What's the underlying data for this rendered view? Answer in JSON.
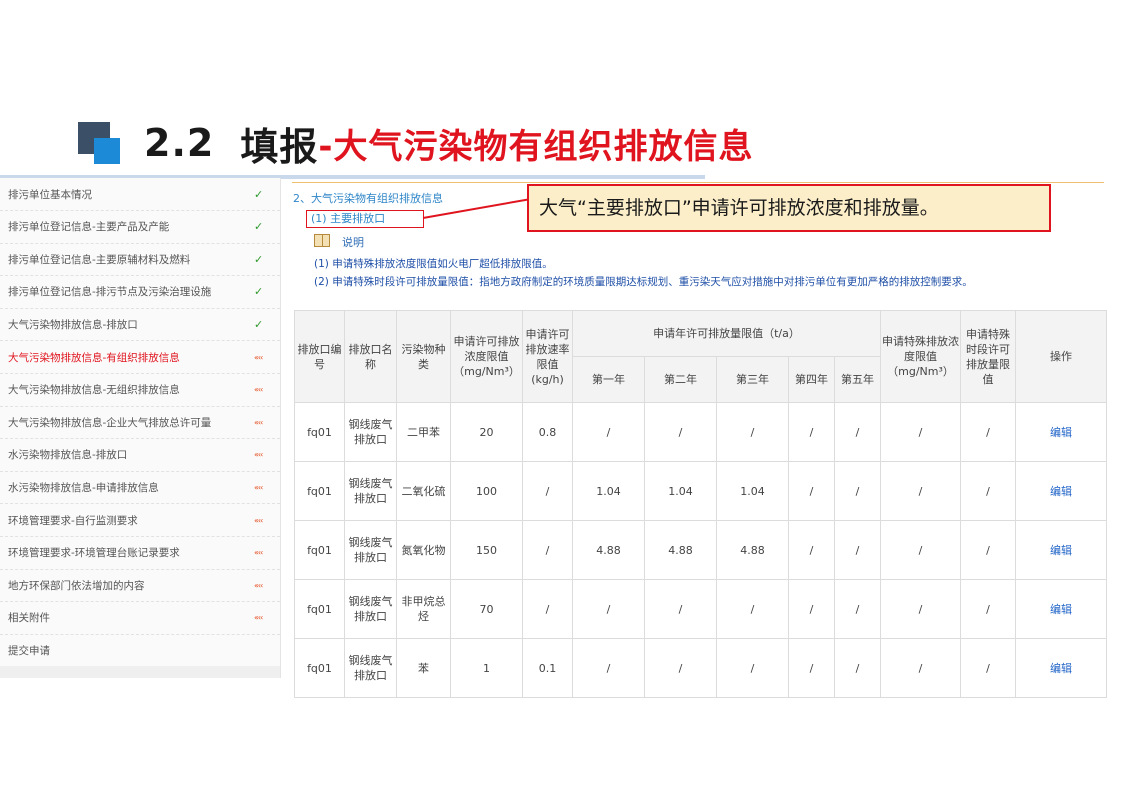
{
  "slide": {
    "title_num": "2.2",
    "title_black": "填报",
    "title_red": "-大气污染物有组织排放信息"
  },
  "sidebar": {
    "items": [
      {
        "label": "排污单位基本情况",
        "status": "ok"
      },
      {
        "label": "排污单位登记信息-主要产品及产能",
        "status": "ok"
      },
      {
        "label": "排污单位登记信息-主要原辅材料及燃料",
        "status": "ok"
      },
      {
        "label": "排污单位登记信息-排污节点及污染治理设施",
        "status": "ok"
      },
      {
        "label": "大气污染物排放信息-排放口",
        "status": "ok"
      },
      {
        "label": "大气污染物排放信息-有组织排放信息",
        "status": "dot",
        "active": true
      },
      {
        "label": "大气污染物排放信息-无组织排放信息",
        "status": "dot"
      },
      {
        "label": "大气污染物排放信息-企业大气排放总许可量",
        "status": "dot"
      },
      {
        "label": "水污染物排放信息-排放口",
        "status": "dot"
      },
      {
        "label": "水污染物排放信息-申请排放信息",
        "status": "dot"
      },
      {
        "label": "环境管理要求-自行监测要求",
        "status": "dot"
      },
      {
        "label": "环境管理要求-环境管理台账记录要求",
        "status": "dot"
      },
      {
        "label": "地方环保部门依法增加的内容",
        "status": "dot"
      },
      {
        "label": "相关附件",
        "status": "dot"
      },
      {
        "label": "提交申请",
        "status": "none"
      }
    ],
    "ok_glyph": "✓",
    "dot_glyph": "«‹‹"
  },
  "main": {
    "section_title": "2、大气污染物有组织排放信息",
    "sub_title": "(1) 主要排放口",
    "note_label": "说明",
    "note1": "(1) 申请特殊排放浓度限值如火电厂超低排放限值。",
    "note2": "(2) 申请特殊时段许可排放量限值：指地方政府制定的环境质量限期达标规划、重污染天气应对措施中对排污单位有更加严格的排放控制要求。"
  },
  "callout": {
    "text": "大气“主要排放口”申请许可排放浓度和排放量。"
  },
  "table": {
    "headers": {
      "outlet_no": "排放口编号",
      "outlet_name": "排放口名称",
      "pollutant": "污染物种类",
      "conc_limit": "申请许可排放浓度限值（mg/Nm³）",
      "rate_limit": "申请许可排放速率限值(kg/h)",
      "annual_group": "申请年许可排放量限值（t/a）",
      "y1": "第一年",
      "y2": "第二年",
      "y3": "第三年",
      "y4": "第四年",
      "y5": "第五年",
      "special_conc": "申请特殊排放浓度限值（mg/Nm³）",
      "special_period": "申请特殊时段许可排放量限值",
      "action": "操作"
    },
    "rows": [
      [
        "fq01",
        "钢线废气排放口",
        "二甲苯",
        "20",
        "0.8",
        "/",
        "/",
        "/",
        "/",
        "/",
        "/",
        "/",
        "编辑"
      ],
      [
        "fq01",
        "钢线废气排放口",
        "二氧化硫",
        "100",
        "/",
        "1.04",
        "1.04",
        "1.04",
        "/",
        "/",
        "/",
        "/",
        "编辑"
      ],
      [
        "fq01",
        "钢线废气排放口",
        "氮氧化物",
        "150",
        "/",
        "4.88",
        "4.88",
        "4.88",
        "/",
        "/",
        "/",
        "/",
        "编辑"
      ],
      [
        "fq01",
        "钢线废气排放口",
        "非甲烷总烃",
        "70",
        "/",
        "/",
        "/",
        "/",
        "/",
        "/",
        "/",
        "/",
        "编辑"
      ],
      [
        "fq01",
        "钢线废气排放口",
        "苯",
        "1",
        "0.1",
        "/",
        "/",
        "/",
        "/",
        "/",
        "/",
        "/",
        "编辑"
      ]
    ]
  }
}
